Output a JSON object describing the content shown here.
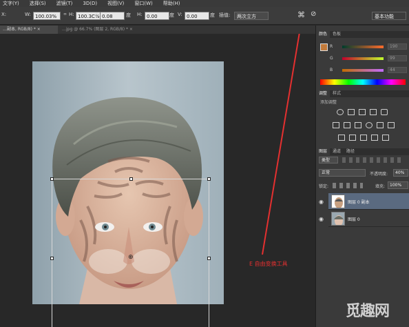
{
  "menubar": {
    "items": [
      "文字(Y)",
      "选择(S)",
      "滤镜(T)",
      "3D(D)",
      "视图(V)",
      "窗口(W)",
      "帮助(H)"
    ]
  },
  "options": {
    "x_label": "X:",
    "w_label": "W:",
    "w_value": "100.03%",
    "h_label": "H:",
    "h_value": "100.3C%",
    "angle_value": "0.08",
    "hskew_label": "H:",
    "hskew_value": "0.00",
    "vskew_label": "V:",
    "vskew_value": "0.00",
    "interp_label": "插值:",
    "interp_value": "两次立方",
    "workspace_value": "基本功能"
  },
  "tabs": [
    {
      "label": "…副本, RGB/8) * ×",
      "active": true
    },
    {
      "label": "…jpg @ 66.7% (图层 2, RGB/8) * ×",
      "active": false
    }
  ],
  "panels": {
    "color_tabs": [
      "颜色",
      "色板"
    ],
    "color_rows": [
      {
        "label": "R",
        "value": "190"
      },
      {
        "label": "G",
        "value": "99"
      },
      {
        "label": "B",
        "value": "44"
      }
    ],
    "adjust_tabs": [
      "调整",
      "样式"
    ],
    "adjust_title": "添加调整",
    "layers_tabs": [
      "图层",
      "通道",
      "路径"
    ],
    "kind_label": "类型",
    "blend_mode": "正常",
    "opacity_label": "不透明度:",
    "opacity_value": "40%",
    "lock_label": "锁定:",
    "fill_label": "填充:",
    "fill_value": "100%",
    "layers": [
      {
        "name": "图层 0 副本",
        "selected": true
      },
      {
        "name": "图层 0",
        "selected": false
      }
    ]
  },
  "annotation": {
    "text": "E 自由变换工具",
    "color": "#e53030"
  },
  "watermark": {
    "text": "觅趣网"
  }
}
